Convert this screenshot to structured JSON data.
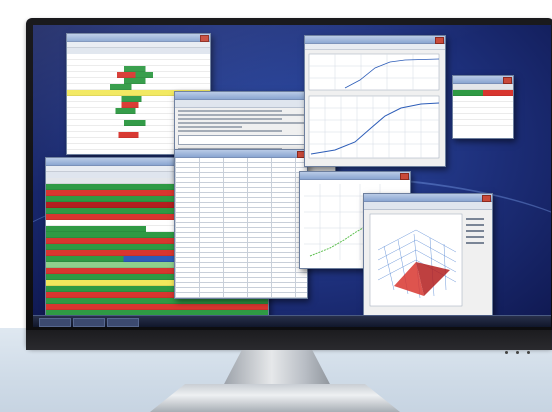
{
  "monitor": {
    "frame_color": "#111114",
    "desktop_color": "#1f3385",
    "stand_color": "#c9ced4"
  },
  "icons": [
    "close-icon",
    "power-led-icon"
  ],
  "windows": [
    {
      "id": "trading-grid-top-left",
      "colors": [
        "#2f9a44",
        "#d8362f",
        "#ffffff",
        "#f2e85c"
      ]
    },
    {
      "id": "market-depth-left",
      "colors": [
        "#2f9a44",
        "#d8362f",
        "#b31f1f",
        "#f2e85c",
        "#8fd08c"
      ]
    },
    {
      "id": "order-entry-center",
      "colors": [
        "#ffffff",
        "#e3e6ea"
      ]
    },
    {
      "id": "data-table-center",
      "colors": [
        "#ffffff"
      ]
    },
    {
      "id": "line-chart-top-right",
      "colors": [
        "#2d5db8",
        "#ffffff"
      ]
    },
    {
      "id": "small-quote-far-right",
      "colors": [
        "#2f9a44",
        "#d8362f"
      ]
    },
    {
      "id": "scatter-chart-mid-right",
      "colors": [
        "#5bbf4d",
        "#ffffff"
      ]
    },
    {
      "id": "surface-3d-chart-bottom-right",
      "colors": [
        "#d8362f",
        "#4a7fd0",
        "#ffffff"
      ]
    }
  ]
}
